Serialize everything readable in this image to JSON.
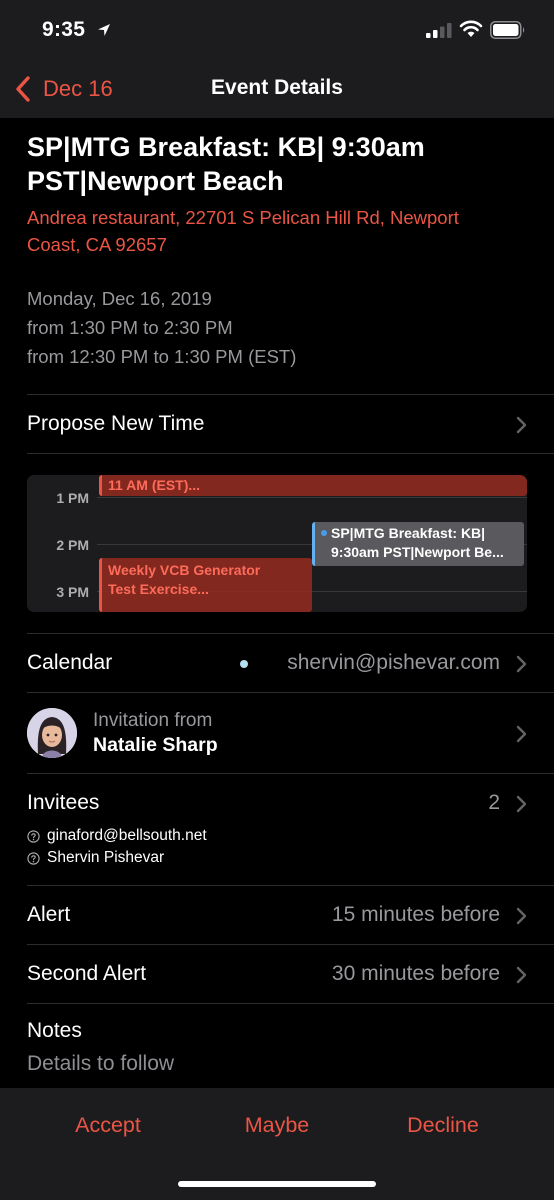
{
  "status_bar": {
    "time": "9:35"
  },
  "nav": {
    "back_label": "Dec 16",
    "title": "Event Details"
  },
  "event": {
    "title_line1": "SP|MTG Breakfast: KB| 9:30am",
    "title_line2": "PST|Newport Beach",
    "location_line1": "Andrea restaurant, 22701 S Pelican Hill Rd, Newport",
    "location_line2": "Coast, CA 92657",
    "date": "Monday, Dec 16, 2019",
    "time_local": "from 1:30 PM to 2:30 PM",
    "time_est": "from 12:30 PM to 1:30 PM (EST)"
  },
  "propose_label": "Propose New Time",
  "mini_calendar": {
    "hours": [
      "1 PM",
      "2 PM",
      "3 PM"
    ],
    "events": [
      {
        "label": "11 AM (EST)..."
      },
      {
        "label_line1": "SP|MTG Breakfast: KB|",
        "label_line2": "9:30am PST|Newport Be..."
      },
      {
        "label_line1": "Weekly VCB Generator",
        "label_line2": "Test Exercise..."
      }
    ]
  },
  "calendar": {
    "label": "Calendar",
    "value": "shervin@pishevar.com",
    "dot_color": "#b5dfee"
  },
  "invitation": {
    "from_label": "Invitation from",
    "name": "Natalie Sharp"
  },
  "invitees": {
    "label": "Invitees",
    "count": "2",
    "list": [
      "ginaford@bellsouth.net",
      "Shervin Pishevar"
    ]
  },
  "alert": {
    "label": "Alert",
    "value": "15 minutes before"
  },
  "second_alert": {
    "label": "Second Alert",
    "value": "30 minutes before"
  },
  "notes": {
    "label": "Notes",
    "text": "Details to follow"
  },
  "actions": {
    "accept": "Accept",
    "maybe": "Maybe",
    "decline": "Decline"
  },
  "colors": {
    "accent": "#eb5545",
    "background": "#000000",
    "bar": "#1c1c1e"
  }
}
